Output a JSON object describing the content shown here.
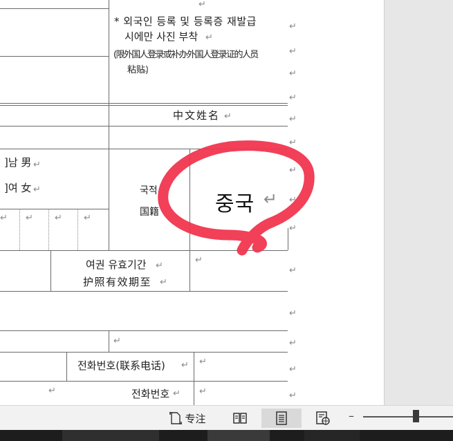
{
  "form": {
    "photo_note_ko_1": "* 외국인 등록 및 등록증 재발급",
    "photo_note_ko_2": "시에만 사진 부착",
    "photo_note_cn_1": "(限外国人登录或补办外国人登录证的人员",
    "photo_note_cn_2": "粘贴)",
    "chinese_name_label": "中文姓名",
    "gender_male": "]남 男",
    "gender_female": "]여 女",
    "nationality_label_ko": "국적",
    "nationality_label_cn": "国籍",
    "nationality_value": "중국",
    "passport_expiry_ko": "여권 유효기간",
    "passport_expiry_cn": "护照有效期至",
    "phone_label_1": "전화번호(联系电话)",
    "phone_label_2": "전화번호",
    "paragraph_mark": "↵"
  },
  "statusbar": {
    "focus_label": "专注",
    "minus": "–"
  },
  "colors": {
    "annotation": "#f0364f",
    "gutter": "#e7e7e7",
    "statusbar": "#f2f2f2"
  }
}
